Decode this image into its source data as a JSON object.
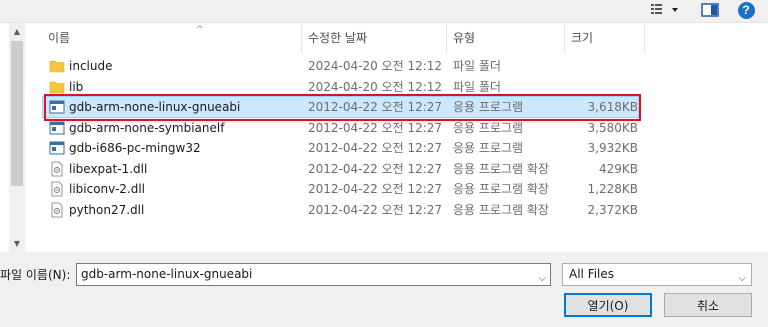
{
  "toolbar": {
    "view_icon": "view-list-icon",
    "preview_icon": "preview-pane-icon",
    "help_label": "?"
  },
  "columns": {
    "name": "이름",
    "date": "수정한 날짜",
    "type": "유형",
    "size": "크기"
  },
  "files": [
    {
      "name": "include",
      "date": "2024-04-20 오전 12:12",
      "type": "파일 폴더",
      "size": "",
      "icon": "folder-icon"
    },
    {
      "name": "lib",
      "date": "2024-04-20 오전 12:12",
      "type": "파일 폴더",
      "size": "",
      "icon": "folder-icon"
    },
    {
      "name": "gdb-arm-none-linux-gnueabi",
      "date": "2012-04-22 오전 12:27",
      "type": "응용 프로그램",
      "size": "3,618KB",
      "icon": "application-icon",
      "selected": true
    },
    {
      "name": "gdb-arm-none-symbianelf",
      "date": "2012-04-22 오전 12:27",
      "type": "응용 프로그램",
      "size": "3,580KB",
      "icon": "application-icon"
    },
    {
      "name": "gdb-i686-pc-mingw32",
      "date": "2012-04-22 오전 12:27",
      "type": "응용 프로그램",
      "size": "3,932KB",
      "icon": "application-icon"
    },
    {
      "name": "libexpat-1.dll",
      "date": "2012-04-22 오전 12:27",
      "type": "응용 프로그램 확장",
      "size": "429KB",
      "icon": "dll-file-icon"
    },
    {
      "name": "libiconv-2.dll",
      "date": "2012-04-22 오전 12:27",
      "type": "응용 프로그램 확장",
      "size": "1,228KB",
      "icon": "dll-file-icon"
    },
    {
      "name": "python27.dll",
      "date": "2012-04-22 오전 12:27",
      "type": "응용 프로그램 확장",
      "size": "2,372KB",
      "icon": "dll-file-icon"
    }
  ],
  "bottom": {
    "filename_label": "파일 이름(N):",
    "filename_value": "gdb-arm-none-linux-gnueabi",
    "filter_value": "All Files",
    "open_label": "열기(O)",
    "cancel_label": "취소"
  },
  "colors": {
    "selected_bg": "#cce8ff",
    "highlight_border": "#e01020",
    "folder": "#f5c542",
    "accent": "#0078d7"
  }
}
